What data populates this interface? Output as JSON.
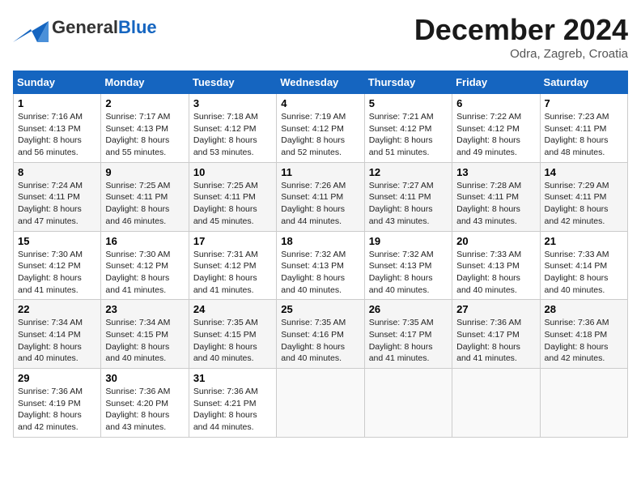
{
  "header": {
    "logo_general": "General",
    "logo_blue": "Blue",
    "month": "December 2024",
    "location": "Odra, Zagreb, Croatia"
  },
  "weekdays": [
    "Sunday",
    "Monday",
    "Tuesday",
    "Wednesday",
    "Thursday",
    "Friday",
    "Saturday"
  ],
  "weeks": [
    [
      {
        "day": "1",
        "sunrise": "Sunrise: 7:16 AM",
        "sunset": "Sunset: 4:13 PM",
        "daylight": "Daylight: 8 hours and 56 minutes."
      },
      {
        "day": "2",
        "sunrise": "Sunrise: 7:17 AM",
        "sunset": "Sunset: 4:13 PM",
        "daylight": "Daylight: 8 hours and 55 minutes."
      },
      {
        "day": "3",
        "sunrise": "Sunrise: 7:18 AM",
        "sunset": "Sunset: 4:12 PM",
        "daylight": "Daylight: 8 hours and 53 minutes."
      },
      {
        "day": "4",
        "sunrise": "Sunrise: 7:19 AM",
        "sunset": "Sunset: 4:12 PM",
        "daylight": "Daylight: 8 hours and 52 minutes."
      },
      {
        "day": "5",
        "sunrise": "Sunrise: 7:21 AM",
        "sunset": "Sunset: 4:12 PM",
        "daylight": "Daylight: 8 hours and 51 minutes."
      },
      {
        "day": "6",
        "sunrise": "Sunrise: 7:22 AM",
        "sunset": "Sunset: 4:12 PM",
        "daylight": "Daylight: 8 hours and 49 minutes."
      },
      {
        "day": "7",
        "sunrise": "Sunrise: 7:23 AM",
        "sunset": "Sunset: 4:11 PM",
        "daylight": "Daylight: 8 hours and 48 minutes."
      }
    ],
    [
      {
        "day": "8",
        "sunrise": "Sunrise: 7:24 AM",
        "sunset": "Sunset: 4:11 PM",
        "daylight": "Daylight: 8 hours and 47 minutes."
      },
      {
        "day": "9",
        "sunrise": "Sunrise: 7:25 AM",
        "sunset": "Sunset: 4:11 PM",
        "daylight": "Daylight: 8 hours and 46 minutes."
      },
      {
        "day": "10",
        "sunrise": "Sunrise: 7:25 AM",
        "sunset": "Sunset: 4:11 PM",
        "daylight": "Daylight: 8 hours and 45 minutes."
      },
      {
        "day": "11",
        "sunrise": "Sunrise: 7:26 AM",
        "sunset": "Sunset: 4:11 PM",
        "daylight": "Daylight: 8 hours and 44 minutes."
      },
      {
        "day": "12",
        "sunrise": "Sunrise: 7:27 AM",
        "sunset": "Sunset: 4:11 PM",
        "daylight": "Daylight: 8 hours and 43 minutes."
      },
      {
        "day": "13",
        "sunrise": "Sunrise: 7:28 AM",
        "sunset": "Sunset: 4:11 PM",
        "daylight": "Daylight: 8 hours and 43 minutes."
      },
      {
        "day": "14",
        "sunrise": "Sunrise: 7:29 AM",
        "sunset": "Sunset: 4:11 PM",
        "daylight": "Daylight: 8 hours and 42 minutes."
      }
    ],
    [
      {
        "day": "15",
        "sunrise": "Sunrise: 7:30 AM",
        "sunset": "Sunset: 4:12 PM",
        "daylight": "Daylight: 8 hours and 41 minutes."
      },
      {
        "day": "16",
        "sunrise": "Sunrise: 7:30 AM",
        "sunset": "Sunset: 4:12 PM",
        "daylight": "Daylight: 8 hours and 41 minutes."
      },
      {
        "day": "17",
        "sunrise": "Sunrise: 7:31 AM",
        "sunset": "Sunset: 4:12 PM",
        "daylight": "Daylight: 8 hours and 41 minutes."
      },
      {
        "day": "18",
        "sunrise": "Sunrise: 7:32 AM",
        "sunset": "Sunset: 4:13 PM",
        "daylight": "Daylight: 8 hours and 40 minutes."
      },
      {
        "day": "19",
        "sunrise": "Sunrise: 7:32 AM",
        "sunset": "Sunset: 4:13 PM",
        "daylight": "Daylight: 8 hours and 40 minutes."
      },
      {
        "day": "20",
        "sunrise": "Sunrise: 7:33 AM",
        "sunset": "Sunset: 4:13 PM",
        "daylight": "Daylight: 8 hours and 40 minutes."
      },
      {
        "day": "21",
        "sunrise": "Sunrise: 7:33 AM",
        "sunset": "Sunset: 4:14 PM",
        "daylight": "Daylight: 8 hours and 40 minutes."
      }
    ],
    [
      {
        "day": "22",
        "sunrise": "Sunrise: 7:34 AM",
        "sunset": "Sunset: 4:14 PM",
        "daylight": "Daylight: 8 hours and 40 minutes."
      },
      {
        "day": "23",
        "sunrise": "Sunrise: 7:34 AM",
        "sunset": "Sunset: 4:15 PM",
        "daylight": "Daylight: 8 hours and 40 minutes."
      },
      {
        "day": "24",
        "sunrise": "Sunrise: 7:35 AM",
        "sunset": "Sunset: 4:15 PM",
        "daylight": "Daylight: 8 hours and 40 minutes."
      },
      {
        "day": "25",
        "sunrise": "Sunrise: 7:35 AM",
        "sunset": "Sunset: 4:16 PM",
        "daylight": "Daylight: 8 hours and 40 minutes."
      },
      {
        "day": "26",
        "sunrise": "Sunrise: 7:35 AM",
        "sunset": "Sunset: 4:17 PM",
        "daylight": "Daylight: 8 hours and 41 minutes."
      },
      {
        "day": "27",
        "sunrise": "Sunrise: 7:36 AM",
        "sunset": "Sunset: 4:17 PM",
        "daylight": "Daylight: 8 hours and 41 minutes."
      },
      {
        "day": "28",
        "sunrise": "Sunrise: 7:36 AM",
        "sunset": "Sunset: 4:18 PM",
        "daylight": "Daylight: 8 hours and 42 minutes."
      }
    ],
    [
      {
        "day": "29",
        "sunrise": "Sunrise: 7:36 AM",
        "sunset": "Sunset: 4:19 PM",
        "daylight": "Daylight: 8 hours and 42 minutes."
      },
      {
        "day": "30",
        "sunrise": "Sunrise: 7:36 AM",
        "sunset": "Sunset: 4:20 PM",
        "daylight": "Daylight: 8 hours and 43 minutes."
      },
      {
        "day": "31",
        "sunrise": "Sunrise: 7:36 AM",
        "sunset": "Sunset: 4:21 PM",
        "daylight": "Daylight: 8 hours and 44 minutes."
      },
      null,
      null,
      null,
      null
    ]
  ]
}
